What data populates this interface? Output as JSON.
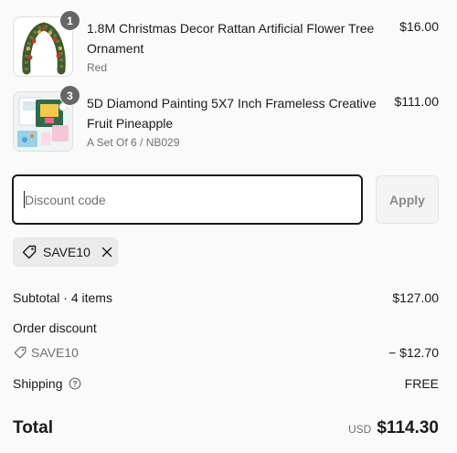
{
  "line_items": [
    {
      "title": "1.8M Christmas Decor Rattan Artificial Flower Tree Ornament",
      "variant": "Red",
      "price": "$16.00",
      "quantity": "1",
      "image_icon": "garland-wreath-thumbnail"
    },
    {
      "title": "5D Diamond Painting 5X7 Inch Frameless Creative Fruit Pineapple",
      "variant": "A Set Of 6 / NB029",
      "price": "$111.00",
      "quantity": "3",
      "image_icon": "diamond-painting-kit-thumbnail"
    }
  ],
  "discount": {
    "placeholder": "Discount code",
    "value": "",
    "apply_label": "Apply"
  },
  "applied_code": {
    "code": "SAVE10",
    "tag_icon": "tag-icon",
    "remove_icon": "close-icon"
  },
  "summary": {
    "subtotal_label": "Subtotal · 4 items",
    "subtotal_value": "$127.00",
    "order_discount_label": "Order discount",
    "discount_code": "SAVE10",
    "discount_value": "− $12.70",
    "shipping_label": "Shipping",
    "shipping_value": "FREE",
    "total_label": "Total",
    "currency": "USD",
    "total_value": "$114.30"
  },
  "colors": {
    "text": "#1a1a1a",
    "muted": "#707070",
    "badge": "#666666",
    "chip_bg": "#ebebeb",
    "border_focus": "#1a1a1a"
  }
}
